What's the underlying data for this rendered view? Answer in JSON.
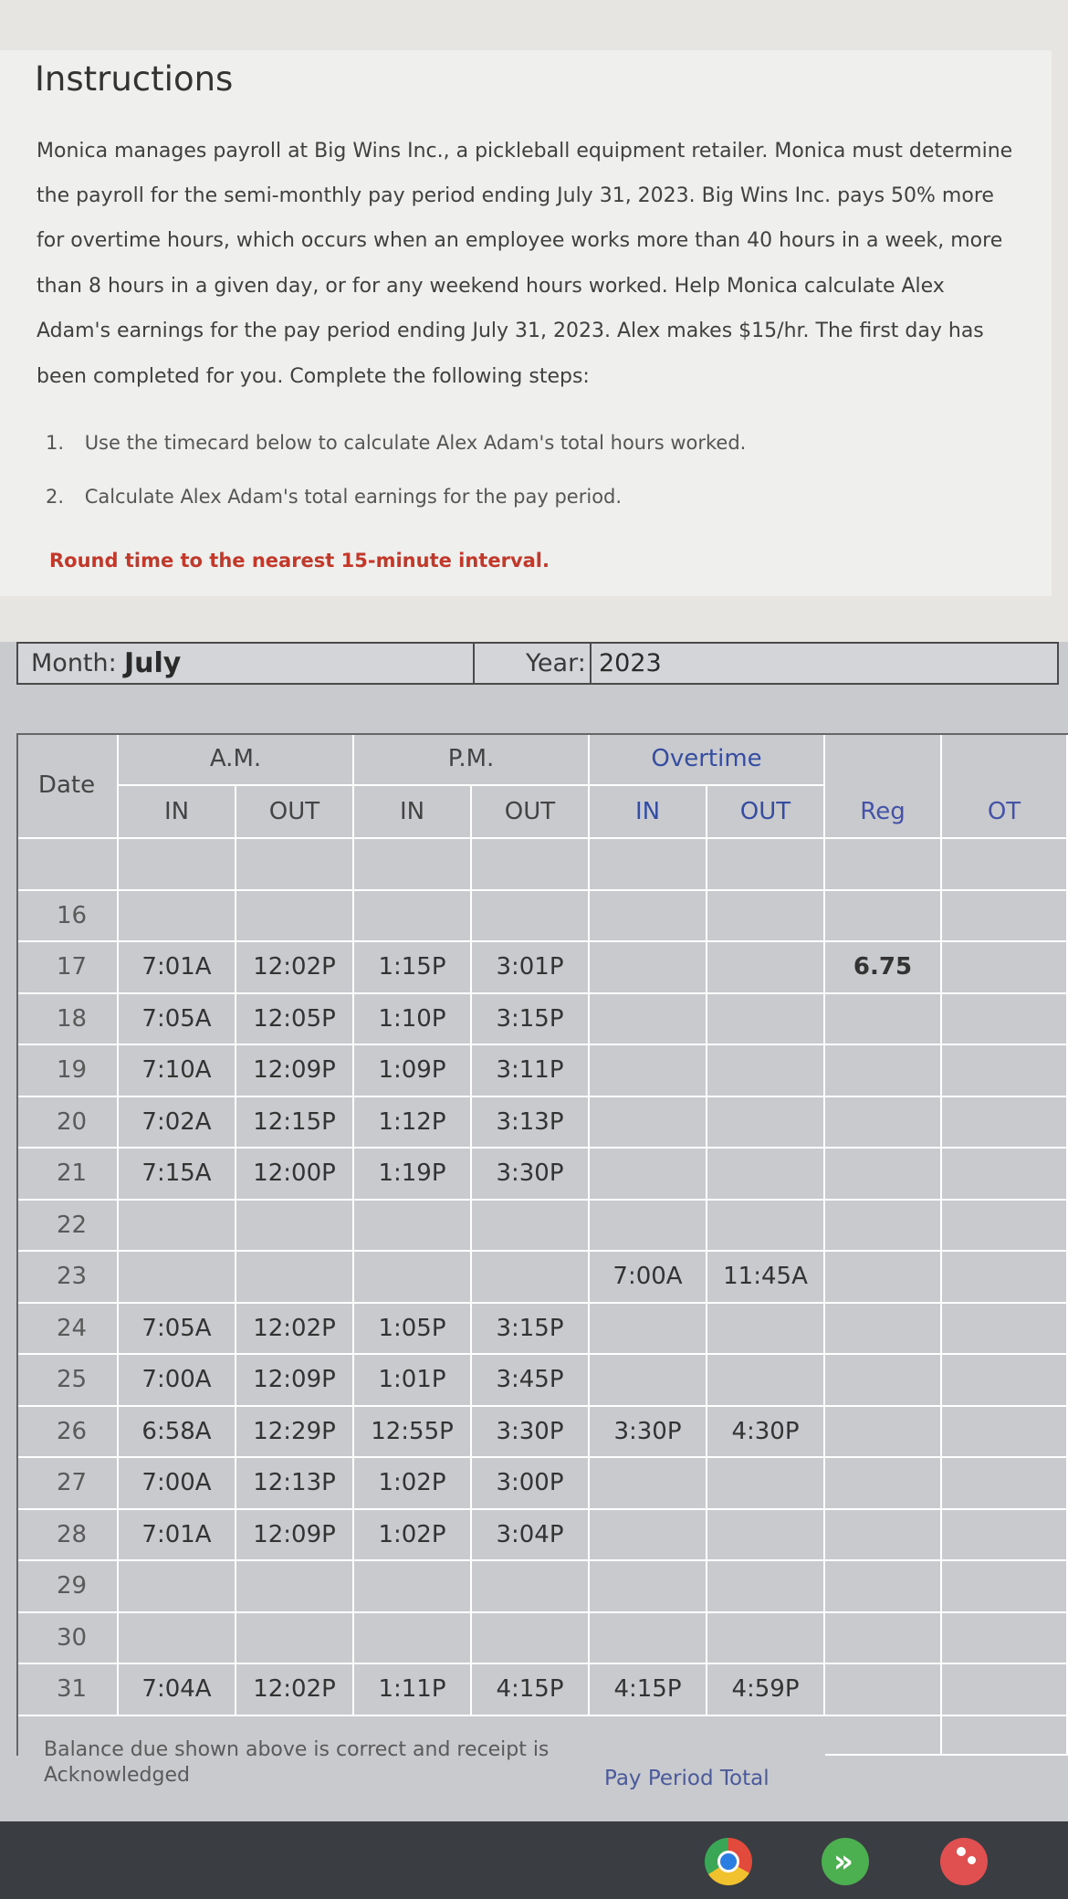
{
  "instructions": {
    "title": "Instructions",
    "paragraph_lines": [
      "Monica manages payroll at Big Wins Inc., a pickleball equipment retailer. Monica must determine",
      "the payroll for the semi-monthly pay period ending July 31, 2023. Big Wins Inc. pays 50% more",
      "for overtime hours, which occurs when an employee works more than 40 hours in a week, more",
      "than 8 hours in a given day, or for any weekend hours worked. Help Monica calculate Alex",
      "Adam's earnings for the pay period ending July 31, 2023. Alex makes $15/hr. The first day has",
      "been completed for you. Complete the following steps:"
    ],
    "steps": [
      {
        "num": "1.",
        "text": "Use the timecard below to calculate Alex Adam's total hours worked."
      },
      {
        "num": "2.",
        "text": "Calculate Alex Adam's total earnings for the pay period."
      }
    ],
    "rounding_note": "Round time to the nearest 15-minute interval."
  },
  "timecard": {
    "month_label": "Month:",
    "month_value": "July",
    "year_label": "Year:",
    "year_value": "2023",
    "headers": {
      "date": "Date",
      "am": "A.M.",
      "pm": "P.M.",
      "overtime": "Overtime",
      "in": "IN",
      "out": "OUT",
      "reg": "Reg",
      "ot": "OT"
    },
    "rows": [
      {
        "date": "",
        "am_in": "",
        "am_out": "",
        "pm_in": "",
        "pm_out": "",
        "ot_in": "",
        "ot_out": "",
        "reg": "",
        "ot": ""
      },
      {
        "date": "16",
        "am_in": "",
        "am_out": "",
        "pm_in": "",
        "pm_out": "",
        "ot_in": "",
        "ot_out": "",
        "reg": "",
        "ot": ""
      },
      {
        "date": "17",
        "am_in": "7:01A",
        "am_out": "12:02P",
        "pm_in": "1:15P",
        "pm_out": "3:01P",
        "ot_in": "",
        "ot_out": "",
        "reg": "6.75",
        "ot": ""
      },
      {
        "date": "18",
        "am_in": "7:05A",
        "am_out": "12:05P",
        "pm_in": "1:10P",
        "pm_out": "3:15P",
        "ot_in": "",
        "ot_out": "",
        "reg": "",
        "ot": ""
      },
      {
        "date": "19",
        "am_in": "7:10A",
        "am_out": "12:09P",
        "pm_in": "1:09P",
        "pm_out": "3:11P",
        "ot_in": "",
        "ot_out": "",
        "reg": "",
        "ot": ""
      },
      {
        "date": "20",
        "am_in": "7:02A",
        "am_out": "12:15P",
        "pm_in": "1:12P",
        "pm_out": "3:13P",
        "ot_in": "",
        "ot_out": "",
        "reg": "",
        "ot": ""
      },
      {
        "date": "21",
        "am_in": "7:15A",
        "am_out": "12:00P",
        "pm_in": "1:19P",
        "pm_out": "3:30P",
        "ot_in": "",
        "ot_out": "",
        "reg": "",
        "ot": ""
      },
      {
        "date": "22",
        "am_in": "",
        "am_out": "",
        "pm_in": "",
        "pm_out": "",
        "ot_in": "",
        "ot_out": "",
        "reg": "",
        "ot": ""
      },
      {
        "date": "23",
        "am_in": "",
        "am_out": "",
        "pm_in": "",
        "pm_out": "",
        "ot_in": "7:00A",
        "ot_out": "11:45A",
        "reg": "",
        "ot": ""
      },
      {
        "date": "24",
        "am_in": "7:05A",
        "am_out": "12:02P",
        "pm_in": "1:05P",
        "pm_out": "3:15P",
        "ot_in": "",
        "ot_out": "",
        "reg": "",
        "ot": ""
      },
      {
        "date": "25",
        "am_in": "7:00A",
        "am_out": "12:09P",
        "pm_in": "1:01P",
        "pm_out": "3:45P",
        "ot_in": "",
        "ot_out": "",
        "reg": "",
        "ot": ""
      },
      {
        "date": "26",
        "am_in": "6:58A",
        "am_out": "12:29P",
        "pm_in": "12:55P",
        "pm_out": "3:30P",
        "ot_in": "3:30P",
        "ot_out": "4:30P",
        "reg": "",
        "ot": ""
      },
      {
        "date": "27",
        "am_in": "7:00A",
        "am_out": "12:13P",
        "pm_in": "1:02P",
        "pm_out": "3:00P",
        "ot_in": "",
        "ot_out": "",
        "reg": "",
        "ot": ""
      },
      {
        "date": "28",
        "am_in": "7:01A",
        "am_out": "12:09P",
        "pm_in": "1:02P",
        "pm_out": "3:04P",
        "ot_in": "",
        "ot_out": "",
        "reg": "",
        "ot": ""
      },
      {
        "date": "29",
        "am_in": "",
        "am_out": "",
        "pm_in": "",
        "pm_out": "",
        "ot_in": "",
        "ot_out": "",
        "reg": "",
        "ot": ""
      },
      {
        "date": "30",
        "am_in": "",
        "am_out": "",
        "pm_in": "",
        "pm_out": "",
        "ot_in": "",
        "ot_out": "",
        "reg": "",
        "ot": ""
      },
      {
        "date": "31",
        "am_in": "7:04A",
        "am_out": "12:02P",
        "pm_in": "1:11P",
        "pm_out": "4:15P",
        "ot_in": "4:15P",
        "ot_out": "4:59P",
        "reg": "",
        "ot": ""
      }
    ],
    "footer_lines": [
      "Balance due shown above is correct and receipt is",
      "Acknowledged"
    ],
    "pay_period_total_label": "Pay Period Total"
  },
  "taskbar": {
    "icons": [
      "chrome-icon",
      "arrow-app-icon",
      "paint-palette-icon"
    ],
    "colors": {
      "bar": "#3a3d42",
      "chrome_blue": "#2a7de1",
      "arrow_green": "#4caf50",
      "palette_red": "#e05050"
    }
  }
}
